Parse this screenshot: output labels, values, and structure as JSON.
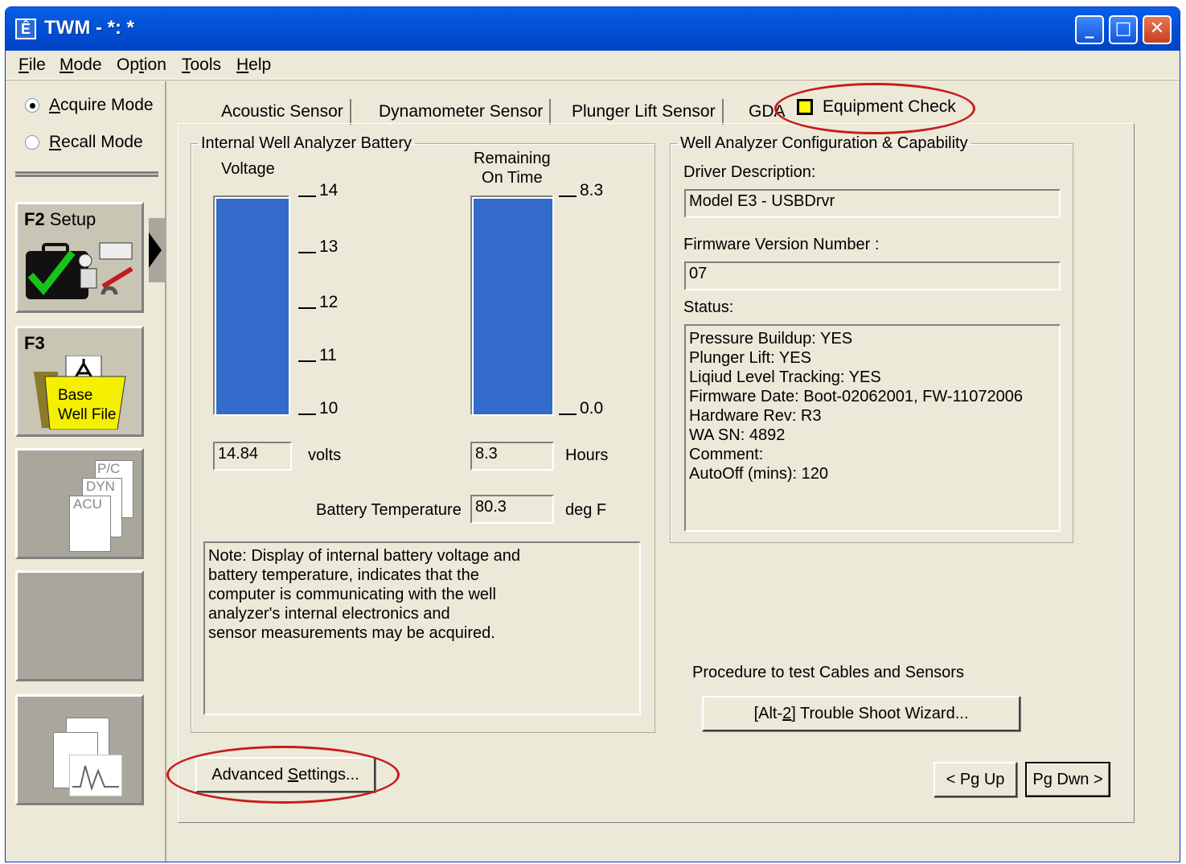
{
  "window": {
    "title": "TWM  -  *: *",
    "icon": "twm-app-icon"
  },
  "titlebar_buttons": {
    "minimize": "_",
    "maximize": "□",
    "close": "✕"
  },
  "menu": [
    {
      "label": "File",
      "u": "F",
      "rest": "ile"
    },
    {
      "label": "Mode",
      "u": "M",
      "rest": "ode"
    },
    {
      "label": "Option",
      "pre": "Op",
      "u": "t",
      "rest": "ion"
    },
    {
      "label": "Tools",
      "u": "T",
      "rest": "ools"
    },
    {
      "label": "Help",
      "u": "H",
      "rest": "elp"
    }
  ],
  "mode": {
    "acquire": {
      "u": "A",
      "rest": "cquire Mode",
      "selected": true
    },
    "recall": {
      "u": "R",
      "rest": "ecall Mode",
      "selected": false
    }
  },
  "nav": {
    "f2": {
      "key": "F2",
      "label": " Setup"
    },
    "f3": {
      "key": "F3",
      "label_line1": "Base",
      "label_line2": "Well File"
    },
    "doc_labels": [
      "P/C",
      "DYN",
      "ACU"
    ]
  },
  "tabs": [
    {
      "label": "Acoustic Sensor"
    },
    {
      "label": "Dynamometer Sensor"
    },
    {
      "label": "Plunger Lift Sensor"
    },
    {
      "label": "GDA"
    },
    {
      "label": "Equipment Check",
      "active": true
    }
  ],
  "battery": {
    "group_title": "Internal Well Analyzer Battery",
    "voltage_label": "Voltage",
    "voltage_ticks": [
      "14",
      "13",
      "12",
      "11",
      "10"
    ],
    "voltage_value": "14.84",
    "voltage_unit": "volts",
    "voltage_level": 1.0,
    "ontime_label_1": "Remaining",
    "ontime_label_2": "On Time",
    "ontime_ticks": [
      "8.3",
      "0.0"
    ],
    "ontime_value": "8.3",
    "ontime_unit": "Hours",
    "ontime_level": 1.0,
    "temp_label": "Battery Temperature",
    "temp_value": "80.3",
    "temp_unit": "deg F",
    "note_lines": [
      "Note:  Display of internal battery voltage and",
      "battery temperature, indicates that the",
      "computer is communicating with the well",
      "analyzer's internal electronics and",
      "sensor measurements may be acquired."
    ]
  },
  "config": {
    "group_title": "Well Analyzer Configuration & Capability",
    "driver_label": "Driver Description:",
    "driver_value": "Model E3 - USBDrvr",
    "firmware_label": "Firmware Version Number :",
    "firmware_value": "07",
    "status_label": "Status:",
    "status_lines": [
      "Pressure Buildup: YES",
      "Plunger Lift: YES",
      "Liqiud Level Tracking: YES",
      "Firmware Date: Boot-02062001, FW-11072006",
      "Hardware Rev: R3",
      "WA SN: 4892",
      "Comment:",
      "AutoOff (mins): 120"
    ]
  },
  "procedure": {
    "label": "Procedure to test Cables and Sensors",
    "wizard_pre": "[Alt-",
    "wizard_u": "2",
    "wizard_post": "]  Trouble Shoot Wizard..."
  },
  "advanced": {
    "pre": "Advanced ",
    "u": "S",
    "post": "ettings..."
  },
  "paging": {
    "pgup": "< Pg Up",
    "pgdn": "Pg Dwn >"
  },
  "colors": {
    "bar": "#336bcc",
    "highlight_ellipse": "#c81c1c",
    "titlebar": "#0353d8"
  }
}
